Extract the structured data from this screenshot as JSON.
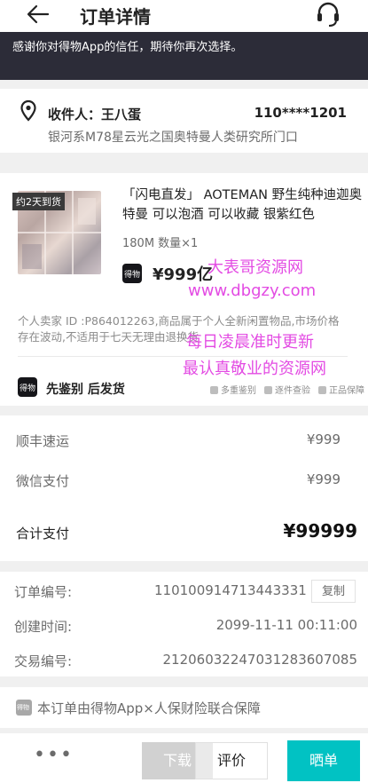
{
  "header": {
    "title": "订单详情",
    "back_icon": "arrow-left-icon",
    "support_icon": "headset-icon"
  },
  "banner": {
    "text": "感谢你对得物App的信任，期待你再次选择。"
  },
  "address": {
    "recipient": "收件人：王八蛋",
    "phone": "110****1201",
    "line": "银河系M78星云光之国奥特曼人类研究所门口"
  },
  "product": {
    "eta_badge": "约2天到货",
    "title": "「闪电直发」 AOTEMAN 野生纯种迪迦奥特曼 可以泡酒 可以收藏 银紫红色",
    "spec": "180M 数量×1",
    "logo_text": "得物",
    "price": "¥999亿",
    "notice": "个人卖家 ID :P864012263,商品属于个人全新闲置物品,市场价格存在波动,不适用于七天无理由退换货",
    "verify_logo_text": "得物",
    "verify_text": "先鉴别 后发货",
    "services": [
      "多重鉴别",
      "逐件查验",
      "正品保障"
    ]
  },
  "watermark": {
    "line1": "大表哥资源网",
    "line2": "www.dbgzy.com",
    "line3": "每日凌晨准时更新",
    "line4": "最认真敬业的资源网"
  },
  "payment": {
    "shipping_label": "顺丰速运",
    "shipping_value": "¥999",
    "method_label": "微信支付",
    "method_value": "¥999",
    "total_label": "合计支付",
    "total_value": "¥99999"
  },
  "order": {
    "number_label": "订单编号:",
    "number_value": "110100914713443331",
    "copy_label": "复制",
    "created_label": "创建时间:",
    "created_value": "2099-11-11 00:11:00",
    "trade_label": "交易编号:",
    "trade_value": "21206032247031283607085"
  },
  "insurance": {
    "logo_text": "得物",
    "text": "本订单由得物App×人保财险联合保障"
  },
  "bottom": {
    "more": "•••",
    "download": "下载",
    "review": "评价",
    "share": "晒单"
  },
  "colors": {
    "accent": "#01c2c3",
    "banner": "#2c2c38",
    "watermark": "#e34be3"
  }
}
